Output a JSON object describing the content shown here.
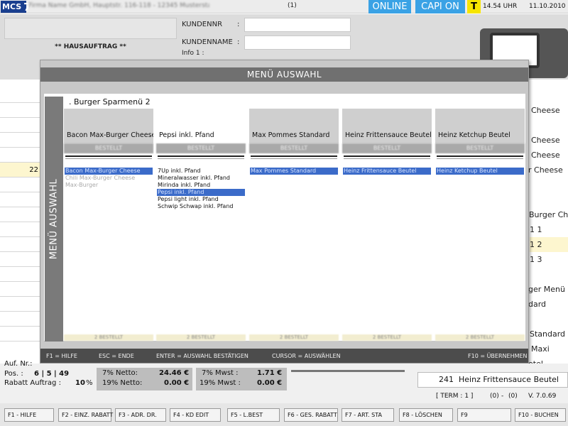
{
  "topbar": {
    "logo": "MCS",
    "logo_num": "7",
    "company_blurred": "Firma Name GmbH, Hauptstr. 116-118 - 12345 Musterstadt",
    "counter": "(1)",
    "online": "ONLINE",
    "capi": "CAPI ON",
    "t_badge": "T",
    "time": "14.54 UHR",
    "date": "11.10.2010"
  },
  "header": {
    "order_type": "** HAUSAUFTRAG **",
    "kundennr_label": "KUNDENNR",
    "kundenname_label": "KUNDENNAME",
    "info_label": "Info 1 :",
    "colon": ":"
  },
  "left_list": {
    "visible_value": "22"
  },
  "right_list": [
    "Cheese",
    "",
    "Cheese",
    "Cheese",
    "r Cheese",
    "",
    "Burger Che",
    "1 1",
    "1 2",
    "1 3",
    "",
    "ger Menü",
    "dard",
    "",
    "Standard",
    "Maxi",
    "etel"
  ],
  "modal": {
    "title": "MENÜ AUSWAHL",
    "side_label": "MENÜ AUSWAHL",
    "menu_name": ".  Burger Sparmenü 2",
    "columns": [
      {
        "header": "Bacon Max-Burger Cheese",
        "sub": "BESTELLT",
        "active": false,
        "items": [
          {
            "label": "Bacon Max-Burger Cheese",
            "state": "sel"
          },
          {
            "label": "Chili Max-Burger Cheese",
            "state": "dim"
          },
          {
            "label": "Max-Burger",
            "state": "dim"
          }
        ]
      },
      {
        "header": "Pepsi inkl. Pfand",
        "sub": "BESTELLT",
        "active": true,
        "items": [
          {
            "label": "7Up inkl. Pfand",
            "state": "norm"
          },
          {
            "label": "Mineralwasser inkl. Pfand",
            "state": "norm"
          },
          {
            "label": "Mirinda inkl. Pfand",
            "state": "norm"
          },
          {
            "label": "Pepsi inkl. Pfand",
            "state": "sel"
          },
          {
            "label": "Pepsi light inkl. Pfand",
            "state": "norm"
          },
          {
            "label": "Schwip Schwap inkl. Pfand",
            "state": "norm"
          }
        ]
      },
      {
        "header": "Max Pommes Standard",
        "sub": "BESTELLT",
        "active": false,
        "items": [
          {
            "label": "Max Pommes Standard",
            "state": "sel"
          }
        ]
      },
      {
        "header": "Heinz Frittensauce Beutel",
        "sub": "BESTELLT",
        "active": false,
        "items": [
          {
            "label": "Heinz Frittensauce Beutel",
            "state": "sel"
          }
        ]
      },
      {
        "header": "Heinz Ketchup Beutel",
        "sub": "BESTELLT",
        "active": false,
        "items": [
          {
            "label": "Heinz Ketchup Beutel",
            "state": "sel"
          }
        ]
      }
    ],
    "col_footer_blur": "2 BESTELLT",
    "footer": {
      "f1": "F1 = HILFE",
      "esc": "ESC = ENDE",
      "enter": "ENTER = AUSWAHL BESTÄTIGEN",
      "cursor": "CURSOR = AUSWÄHLEN",
      "f10": "F10 = ÜBERNEHMEN"
    }
  },
  "stats": {
    "auf_nr": "Auf. Nr.:",
    "pos_label": "Pos. :",
    "pos_values": "6 | 5 | 49",
    "rabatt_label": "Rabatt Auftrag :",
    "rabatt_value": "10",
    "percent": "%",
    "netto7_label": "7% Netto:",
    "netto7_value": "24.46 €",
    "netto19_label": "19% Netto:",
    "netto19_value": "0.00 €",
    "mwst7_label": "7% Mwst :",
    "mwst7_value": "1.71 €",
    "mwst19_label": "19% Mwst :",
    "mwst19_value": "0.00 €",
    "last_qty": "241",
    "last_item": "Heinz Frittensauce Beutel",
    "term": "[ TERM : 1 ]",
    "paren1": "(0)",
    "dash": "-",
    "paren2": "(0)",
    "version": "V. 7.0.69"
  },
  "fkeys": [
    "F1 - HILFE",
    "F2 - EINZ. RABATT",
    "F3 - ADR. DR.",
    "F4 - KD EDIT",
    "F5 - L.BEST",
    "F6 - GES. RABATT",
    "F7 - ART. STA",
    "F8 - LÖSCHEN",
    "F9",
    "F10 - BUCHEN"
  ]
}
